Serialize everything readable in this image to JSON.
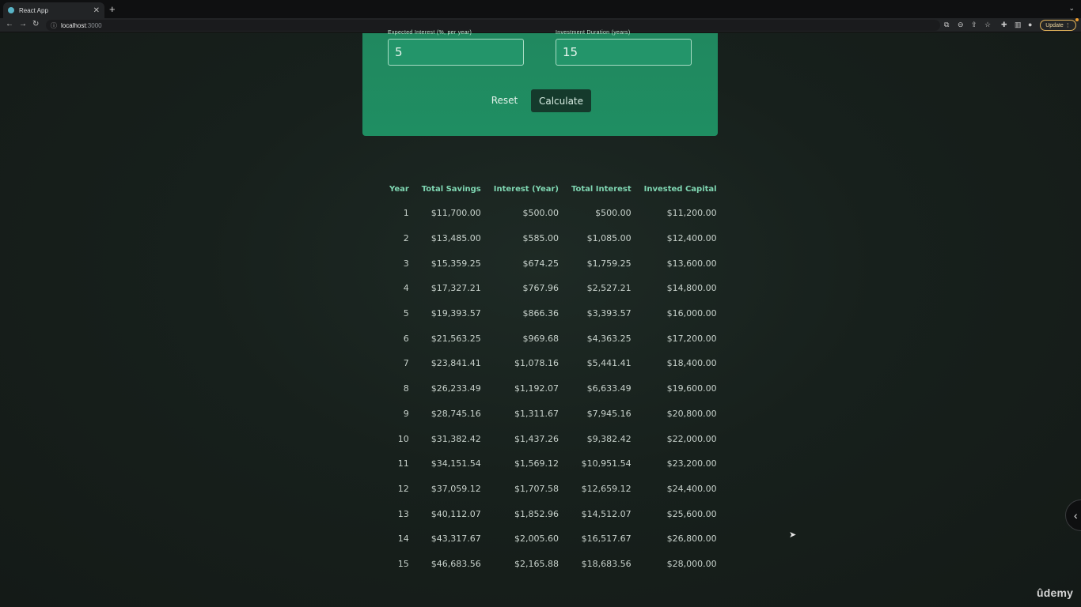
{
  "browser": {
    "tab_title": "React App",
    "url_host": "localhost",
    "url_port": ":3000",
    "update_label": "Update"
  },
  "form": {
    "expected_return_label": "Expected Interest (%, per year)",
    "expected_return_value": "5",
    "duration_label": "Investment Duration (years)",
    "duration_value": "15",
    "reset_label": "Reset",
    "calculate_label": "Calculate"
  },
  "table": {
    "headers": [
      "Year",
      "Total Savings",
      "Interest (Year)",
      "Total Interest",
      "Invested Capital"
    ],
    "rows": [
      [
        "1",
        "$11,700.00",
        "$500.00",
        "$500.00",
        "$11,200.00"
      ],
      [
        "2",
        "$13,485.00",
        "$585.00",
        "$1,085.00",
        "$12,400.00"
      ],
      [
        "3",
        "$15,359.25",
        "$674.25",
        "$1,759.25",
        "$13,600.00"
      ],
      [
        "4",
        "$17,327.21",
        "$767.96",
        "$2,527.21",
        "$14,800.00"
      ],
      [
        "5",
        "$19,393.57",
        "$866.36",
        "$3,393.57",
        "$16,000.00"
      ],
      [
        "6",
        "$21,563.25",
        "$969.68",
        "$4,363.25",
        "$17,200.00"
      ],
      [
        "7",
        "$23,841.41",
        "$1,078.16",
        "$5,441.41",
        "$18,400.00"
      ],
      [
        "8",
        "$26,233.49",
        "$1,192.07",
        "$6,633.49",
        "$19,600.00"
      ],
      [
        "9",
        "$28,745.16",
        "$1,311.67",
        "$7,945.16",
        "$20,800.00"
      ],
      [
        "10",
        "$31,382.42",
        "$1,437.26",
        "$9,382.42",
        "$22,000.00"
      ],
      [
        "11",
        "$34,151.54",
        "$1,569.12",
        "$10,951.54",
        "$23,200.00"
      ],
      [
        "12",
        "$37,059.12",
        "$1,707.58",
        "$12,659.12",
        "$24,400.00"
      ],
      [
        "13",
        "$40,112.07",
        "$1,852.96",
        "$14,512.07",
        "$25,600.00"
      ],
      [
        "14",
        "$43,317.67",
        "$2,005.60",
        "$16,517.67",
        "$26,800.00"
      ],
      [
        "15",
        "$46,683.56",
        "$2,165.88",
        "$18,683.56",
        "$28,000.00"
      ]
    ]
  },
  "watermark": "ûdemy",
  "colors": {
    "form_bg": "#1f8e62",
    "header_text": "#7fd6b2",
    "calculate_bg": "#153a2c",
    "page_bg": "#161a18"
  }
}
